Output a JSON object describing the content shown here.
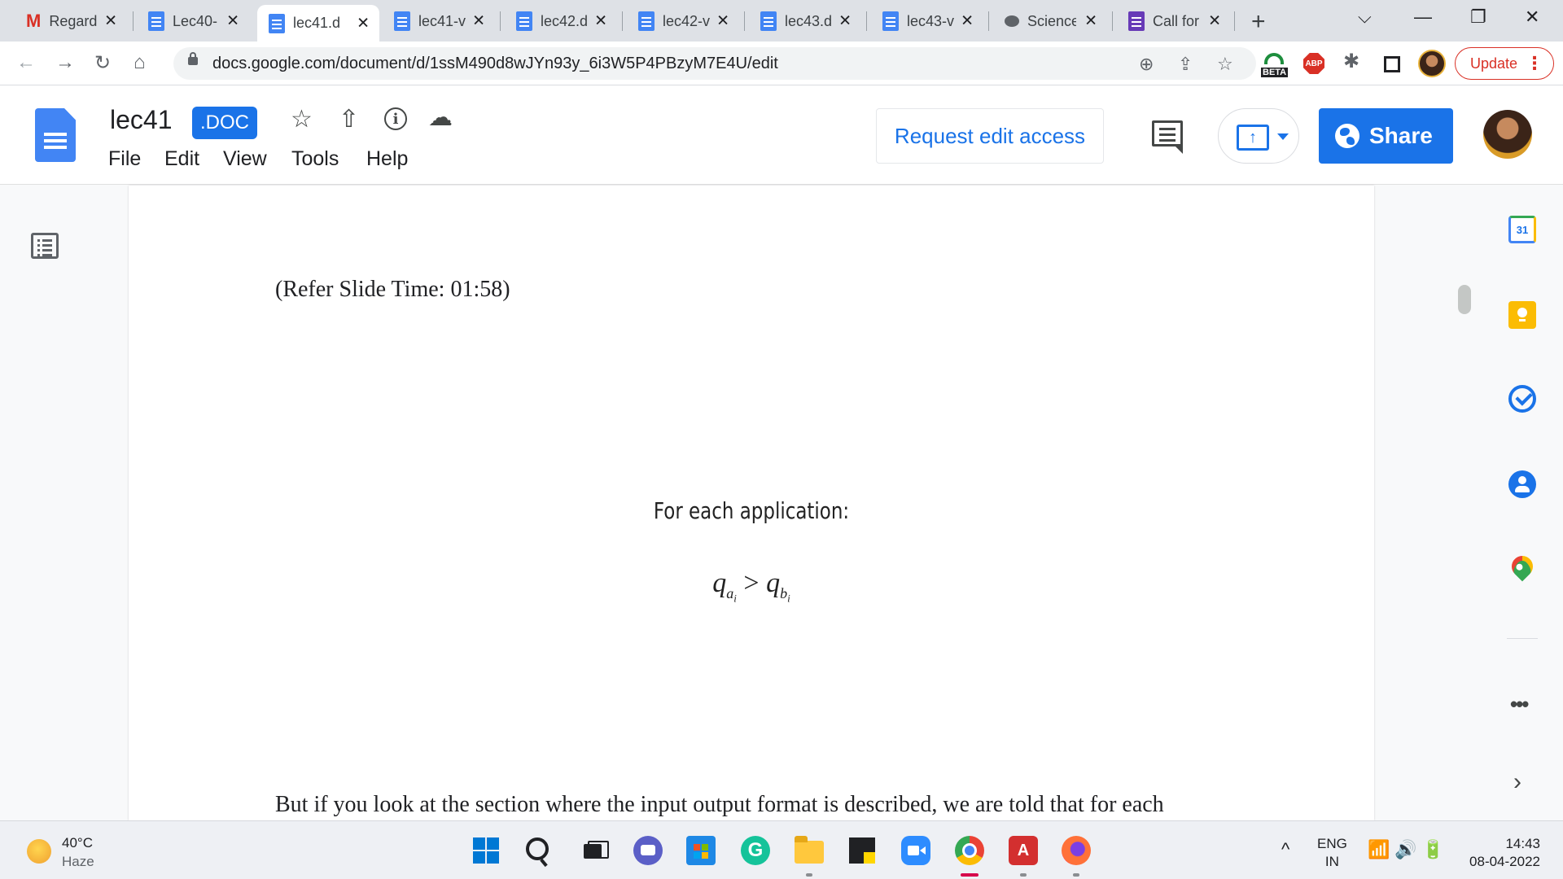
{
  "browser": {
    "tabs": [
      {
        "title": "Regard",
        "icon": "gmail-icon",
        "active": false
      },
      {
        "title": "Lec40-",
        "icon": "docs-icon",
        "active": false
      },
      {
        "title": "lec41.d",
        "icon": "docs-icon",
        "active": true
      },
      {
        "title": "lec41-v",
        "icon": "docs-icon",
        "active": false
      },
      {
        "title": "lec42.d",
        "icon": "docs-icon",
        "active": false
      },
      {
        "title": "lec42-v",
        "icon": "docs-icon",
        "active": false
      },
      {
        "title": "lec43.d",
        "icon": "docs-icon",
        "active": false
      },
      {
        "title": "lec43-v",
        "icon": "docs-icon",
        "active": false
      },
      {
        "title": "Science",
        "icon": "brain-icon",
        "active": false
      },
      {
        "title": "Call for",
        "icon": "forms-icon",
        "active": false
      }
    ],
    "tab_close": "✕",
    "new_tab": "+",
    "window_controls": {
      "dropdown": "⌵",
      "minimize": "—",
      "restore": "❐",
      "close": "✕"
    },
    "nav": {
      "back": "←",
      "forward": "→",
      "reload": "↻",
      "home": "⌂"
    },
    "url": "docs.google.com/document/d/1ssM490d8wJYn93y_6i3W5P4PBzyM7E4U/edit",
    "omnibox_icons": {
      "zoom": "⊕",
      "share": "⇪",
      "bookmark": "☆"
    },
    "extensions": {
      "beta_label": "BETA",
      "abp_label": "ABP",
      "puzzle": "✱"
    },
    "update_label": "Update",
    "update_menu": "⋮"
  },
  "docs": {
    "title": "lec41",
    "badge": ".DOC",
    "star": "☆",
    "drive_icon": "⇧",
    "info": "i",
    "cloud": "☁",
    "menu": [
      "File",
      "Edit",
      "View",
      "Tools",
      "Help"
    ],
    "request_edit_label": "Request edit access",
    "move_arrow": "↑",
    "share_label": "Share"
  },
  "document": {
    "refer_line": "(Refer Slide Time: 01:58)",
    "slide_heading": "For each application:",
    "formula": {
      "lhs": "q",
      "lhs_sub": "a",
      "lhs_sub2": "i",
      "op": " > ",
      "rhs": "q",
      "rhs_sub": "b",
      "rhs_sub2": "i"
    },
    "body_line": "But if you look at the section where the input output format is described, we are told that for each"
  },
  "side_panel": {
    "calendar_day": "31",
    "more": "•••",
    "expand": "›"
  },
  "taskbar": {
    "weather_temp": "40°C",
    "weather_desc": "Haze",
    "grammarly_letter": "G",
    "tray_chevron": "^",
    "lang_line1": "ENG",
    "lang_line2": "IN",
    "tray_icons": "📶🔊🔋",
    "time": "14:43",
    "date": "08-04-2022"
  },
  "colors": {
    "accent": "#1a73e8",
    "docs_blue": "#4285f4",
    "update_red": "#d93025"
  }
}
